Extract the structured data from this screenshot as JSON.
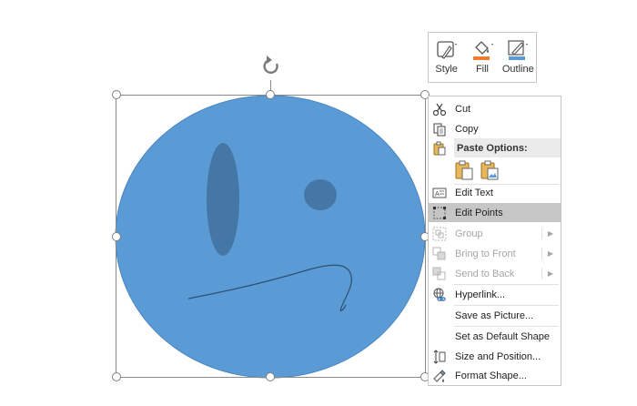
{
  "mini_toolbar": {
    "style_label": "Style",
    "fill_label": "Fill",
    "outline_label": "Outline",
    "colors": {
      "fill_bar": "#ED7D31",
      "outline_bar": "#5B9BD5"
    }
  },
  "shape": {
    "fill_color": "#5B9BD5",
    "feature_color": "#41719C"
  },
  "context_menu": {
    "cut": "Cut",
    "copy": "Copy",
    "paste_options": "Paste Options:",
    "edit_text": "Edit Text",
    "edit_points": "Edit Points",
    "group": "Group",
    "bring_to_front": "Bring to Front",
    "send_to_back": "Send to Back",
    "hyperlink": "Hyperlink...",
    "save_as_picture": "Save as Picture...",
    "set_default_shape": "Set as Default Shape",
    "size_and_position": "Size and Position...",
    "format_shape": "Format Shape..."
  }
}
